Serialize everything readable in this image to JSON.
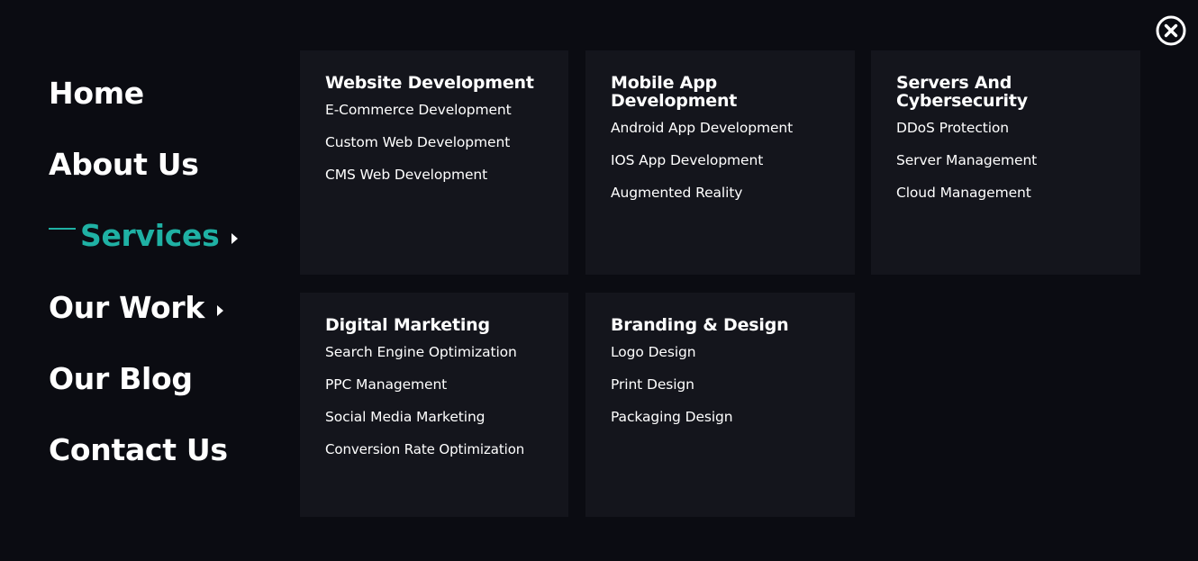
{
  "close": {
    "icon": "close-circle-icon"
  },
  "nav": {
    "home": "Home",
    "about": "About Us",
    "services": "Services",
    "work": "Our Work",
    "blog": "Our Blog",
    "contact": "Contact Us"
  },
  "colors": {
    "background": "#0b0c12",
    "panel": "#14151c",
    "accent": "#1fb1a4",
    "text": "#ffffff"
  },
  "panels": [
    {
      "title": "Website Development",
      "links": [
        "E-Commerce Development",
        "Custom Web Development",
        "CMS Web Development"
      ]
    },
    {
      "title": "Mobile App Development",
      "links": [
        "Android App Development",
        "IOS App Development",
        "Augmented Reality"
      ]
    },
    {
      "title": "Servers And Cybersecurity",
      "links": [
        "DDoS Protection",
        "Server Management",
        "Cloud Management"
      ]
    },
    {
      "title": "Digital Marketing",
      "links": [
        "Search Engine Optimization",
        "PPC Management",
        "Social Media Marketing",
        "Conversion Rate Optimization"
      ]
    },
    {
      "title": "Branding & Design",
      "links": [
        "Logo Design",
        "Print Design",
        "Packaging Design"
      ]
    }
  ]
}
